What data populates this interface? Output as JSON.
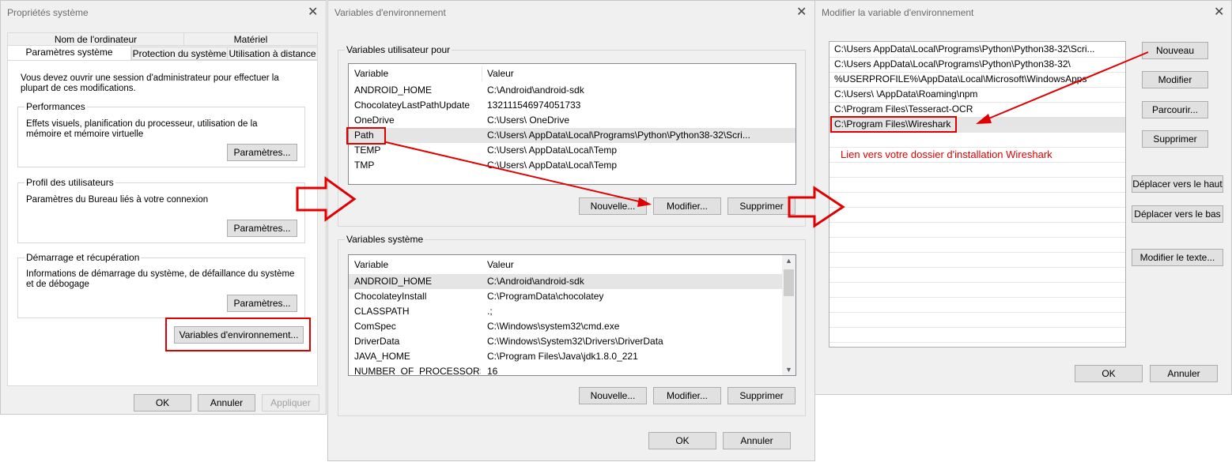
{
  "sys": {
    "title": "Propriétés système",
    "tabs_top": [
      "Nom de l'ordinateur",
      "Matériel"
    ],
    "tabs_bottom": [
      "Paramètres système avancés",
      "Protection du système",
      "Utilisation à distance"
    ],
    "intro": "Vous devez ouvrir une session d'administrateur pour effectuer la plupart de ces modifications.",
    "perf": {
      "label": "Performances",
      "desc": "Effets visuels, planification du processeur, utilisation de la mémoire et mémoire virtuelle",
      "button": "Paramètres..."
    },
    "profil": {
      "label": "Profil des utilisateurs",
      "desc": "Paramètres du Bureau liés à votre connexion",
      "button": "Paramètres..."
    },
    "demarrage": {
      "label": "Démarrage et récupération",
      "desc": "Informations de démarrage du système, de défaillance du système et de débogage",
      "button": "Paramètres..."
    },
    "env_button": "Variables d'environnement...",
    "ok": "OK",
    "cancel": "Annuler",
    "apply": "Appliquer"
  },
  "env": {
    "title": "Variables d'environnement",
    "user_label": "Variables utilisateur pour",
    "col_var": "Variable",
    "col_val": "Valeur",
    "user_rows": [
      {
        "var": "ANDROID_HOME",
        "val": "C:\\Android\\android-sdk"
      },
      {
        "var": "ChocolateyLastPathUpdate",
        "val": "132111546974051733"
      },
      {
        "var": "OneDrive",
        "val": "C:\\Users\\       OneDrive"
      },
      {
        "var": "Path",
        "val": "C:\\Users\\       AppData\\Local\\Programs\\Python\\Python38-32\\Scri..."
      },
      {
        "var": "TEMP",
        "val": "C:\\Users\\       AppData\\Local\\Temp"
      },
      {
        "var": "TMP",
        "val": "C:\\Users\\       AppData\\Local\\Temp"
      }
    ],
    "new": "Nouvelle...",
    "edit": "Modifier...",
    "delete": "Supprimer",
    "sys_label": "Variables système",
    "sys_rows": [
      {
        "var": "ANDROID_HOME",
        "val": "C:\\Android\\android-sdk"
      },
      {
        "var": "ChocolateyInstall",
        "val": "C:\\ProgramData\\chocolatey"
      },
      {
        "var": "CLASSPATH",
        "val": ".;"
      },
      {
        "var": "ComSpec",
        "val": "C:\\Windows\\system32\\cmd.exe"
      },
      {
        "var": "DriverData",
        "val": "C:\\Windows\\System32\\Drivers\\DriverData"
      },
      {
        "var": "JAVA_HOME",
        "val": "C:\\Program Files\\Java\\jdk1.8.0_221"
      },
      {
        "var": "NUMBER_OF_PROCESSORS",
        "val": "16"
      }
    ],
    "ok": "OK",
    "cancel": "Annuler"
  },
  "edit": {
    "title": "Modifier la variable d'environnement",
    "entries": [
      "C:\\Users        AppData\\Local\\Programs\\Python\\Python38-32\\Scri...",
      "C:\\Users        AppData\\Local\\Programs\\Python\\Python38-32\\",
      "%USERPROFILE%\\AppData\\Local\\Microsoft\\WindowsApps",
      "C:\\Users\\       \\AppData\\Roaming\\npm",
      "C:\\Program Files\\Tesseract-OCR",
      "C:\\Program Files\\Wireshark"
    ],
    "annotation": "Lien vers votre dossier d'installation Wireshark",
    "buttons": {
      "new": "Nouveau",
      "modify": "Modifier",
      "browse": "Parcourir...",
      "delete": "Supprimer",
      "up": "Déplacer vers le haut",
      "down": "Déplacer vers le bas",
      "edit_text": "Modifier le texte...",
      "ok": "OK",
      "cancel": "Annuler"
    }
  },
  "colors": {
    "accent_red": "#e00000",
    "selected_row": "#e5e5e5",
    "annotation_text": "#e00000"
  }
}
